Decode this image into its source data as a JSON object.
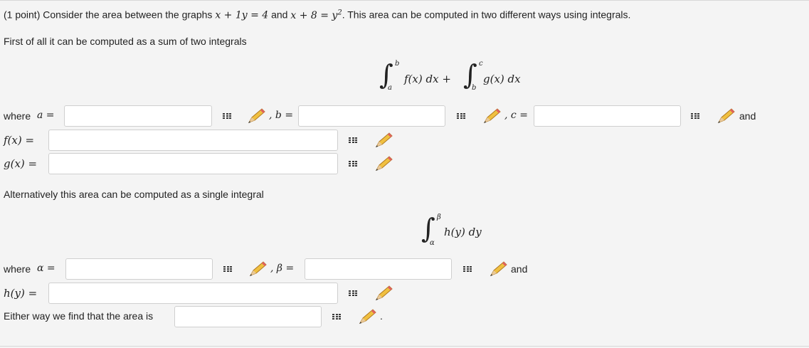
{
  "problem": {
    "points": "(1 point)",
    "intro_a": "Consider the area between the graphs",
    "eq1": "x + 1y = 4",
    "and_word": "and",
    "eq2": "x + 8 = y",
    "eq2_sup": "2",
    "intro_b": ". This area can be computed in two different ways using integrals."
  },
  "part1": {
    "sentence": "First of all it can be computed as a sum of two integrals",
    "integral": {
      "lower1": "a",
      "upper1": "b",
      "integrand1": "f(x) dx +",
      "lower2": "b",
      "upper2": "c",
      "integrand2": "g(x) dx"
    },
    "where_label": "where",
    "a_label": "a =",
    "b_label": ", b =",
    "c_label": ", c =",
    "and_label": "and",
    "f_label": "f(x) =",
    "g_label": "g(x) =",
    "values": {
      "a": "",
      "b": "",
      "c": "",
      "f": "",
      "g": ""
    }
  },
  "part2": {
    "sentence": "Alternatively this area can be computed as a single integral",
    "integral": {
      "lower": "α",
      "upper": "β",
      "integrand": "h(y) dy"
    },
    "where_label": "where",
    "alpha_label": "α =",
    "beta_label": ", β =",
    "and_label": "and",
    "h_label": "h(y) =",
    "values": {
      "alpha": "",
      "beta": "",
      "h": ""
    }
  },
  "final": {
    "sentence": "Either way we find that the area is",
    "period": ".",
    "value": ""
  },
  "icons": {
    "matrix": "matrix-grid-icon",
    "pencil": "pencil-icon"
  }
}
